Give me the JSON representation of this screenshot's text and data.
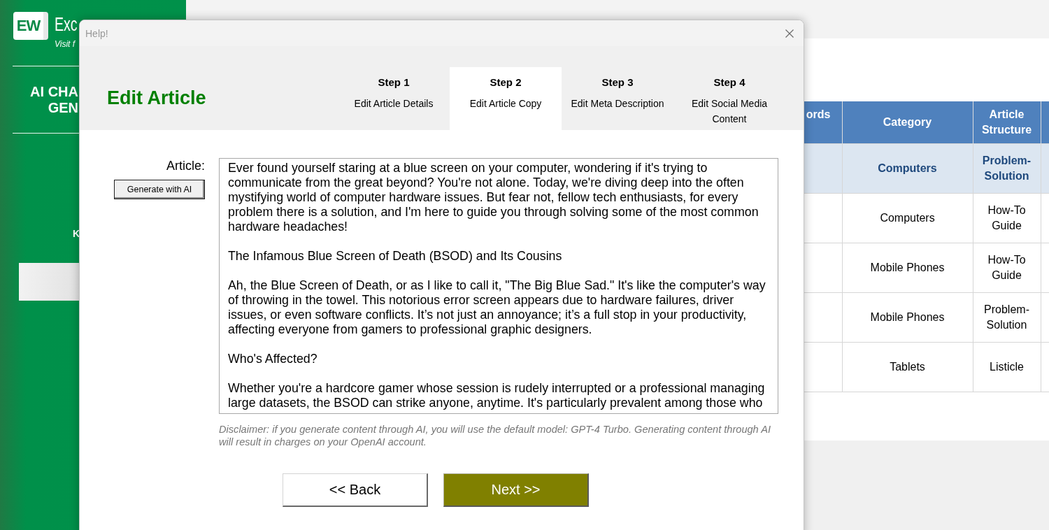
{
  "sidebar": {
    "logo": "EW",
    "brand": "Exc",
    "tagline": "Visit f",
    "heading": [
      "AI CHA",
      "GEN"
    ],
    "label": "K"
  },
  "sheet": {
    "table": {
      "columns": [
        "ords",
        "Category",
        "Article Structure"
      ],
      "rows": [
        {
          "category": "Computers",
          "structure": "Problem-Solution",
          "selected": true
        },
        {
          "category": "Computers",
          "structure": "How-To Guide",
          "selected": false
        },
        {
          "category": "Mobile Phones",
          "structure": "How-To Guide",
          "selected": false
        },
        {
          "category": "Mobile Phones",
          "structure": "Problem-Solution",
          "selected": false
        },
        {
          "category": "Tablets",
          "structure": "Listicle",
          "selected": false
        }
      ]
    }
  },
  "dialog": {
    "title": "Help!",
    "heading": "Edit Article",
    "steps": [
      {
        "title": "Step 1",
        "subtitle": "Edit Article Details",
        "selected": false
      },
      {
        "title": "Step 2",
        "subtitle": "Edit Article Copy",
        "selected": true
      },
      {
        "title": "Step 3",
        "subtitle": "Edit Meta Description",
        "selected": false
      },
      {
        "title": "Step 4",
        "subtitle": "Edit Social Media Content",
        "selected": false
      }
    ],
    "article": {
      "label": "Article:",
      "generate_button": "Generate with AI",
      "value": "Ever found yourself staring at a blue screen on your computer, wondering if it's trying to communicate from the great beyond? You're not alone. Today, we're diving deep into the often mystifying world of computer hardware issues. But fear not, fellow tech enthusiasts, for every problem there is a solution, and I'm here to guide you through solving some of the most common hardware headaches!\n\nThe Infamous Blue Screen of Death (BSOD) and Its Cousins\n\nAh, the Blue Screen of Death, or as I like to call it, \"The Big Blue Sad.\" It's like the computer's way of throwing in the towel. This notorious error screen appears due to hardware failures, driver issues, or even software conflicts. It’s not just an annoyance; it’s a full stop in your productivity, affecting everyone from gamers to professional graphic designers.\n\nWho's Affected?\n\nWhether you're a hardcore gamer whose session is rudely interrupted or a professional managing large datasets, the BSOD can strike anyone, anytime. It's particularly prevalent among those who"
    },
    "disclaimer": "Disclaimer: if you generate content through AI, you will use the default model: GPT-4 Turbo. Generating content through AI will result in charges on your OpenAI account.",
    "buttons": [
      {
        "label": "<< Back",
        "kind": "secondary"
      },
      {
        "label": "Next >>",
        "kind": "primary"
      }
    ]
  }
}
